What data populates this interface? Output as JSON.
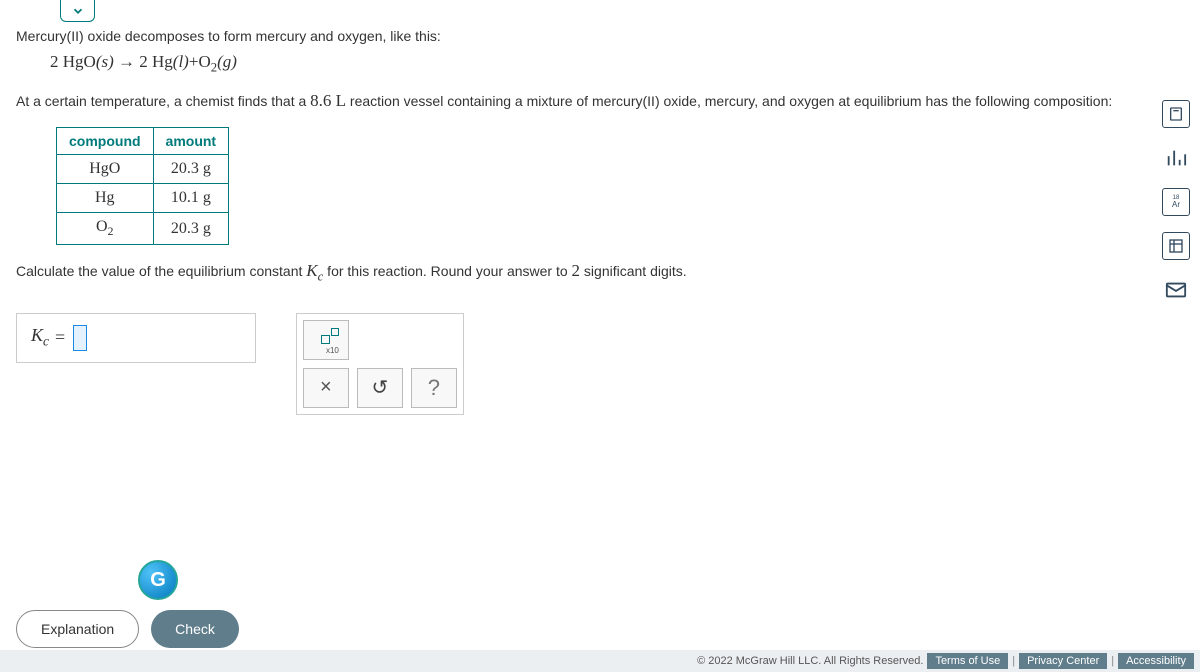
{
  "dropdown_icon": "chevron-down",
  "problem": {
    "line1": "Mercury(II) oxide decomposes to form mercury and oxygen, like this:",
    "equation_lhs": "2 HgO",
    "equation_arrow": "→",
    "equation_rhs_part1": "2 Hg",
    "equation_rhs_state1": "(l)",
    "equation_plus": "+",
    "equation_rhs_part2": "O",
    "equation_rhs_sub": "2",
    "equation_rhs_state2": "(g)",
    "equation_lhs_state": "(s)",
    "line2_a": "At a certain temperature, a chemist finds that a ",
    "vessel_size": "8.6 L",
    "line2_b": " reaction vessel containing a mixture of mercury(II) oxide, mercury, and oxygen at equilibrium has the following composition:",
    "table": {
      "header_compound": "compound",
      "header_amount": "amount",
      "rows": [
        {
          "compound": "HgO",
          "amount": "20.3 g"
        },
        {
          "compound": "Hg",
          "amount": "10.1 g"
        },
        {
          "compound_base": "O",
          "compound_sub": "2",
          "amount": "20.3 g"
        }
      ]
    },
    "line3_a": "Calculate the value of the equilibrium constant ",
    "kc_symbol": "K",
    "kc_sub": "c",
    "line3_b": " for this reaction. Round your answer to ",
    "sig_digits": "2",
    "line3_c": " significant digits."
  },
  "answer": {
    "label_k": "K",
    "label_sub": "c",
    "equals": "="
  },
  "tools": {
    "sci_label": "x10",
    "clear": "×",
    "undo": "↺",
    "help": "?"
  },
  "side": {
    "calculator": "calc",
    "graph": "graph",
    "periodic": "Ar",
    "ruler": "ruler",
    "mail": "mail"
  },
  "badge": "G",
  "buttons": {
    "explanation": "Explanation",
    "check": "Check"
  },
  "footer": {
    "copyright": "© 2022 McGraw Hill LLC. All Rights Reserved.",
    "terms": "Terms of Use",
    "privacy": "Privacy Center",
    "accessibility": "Accessibility"
  }
}
